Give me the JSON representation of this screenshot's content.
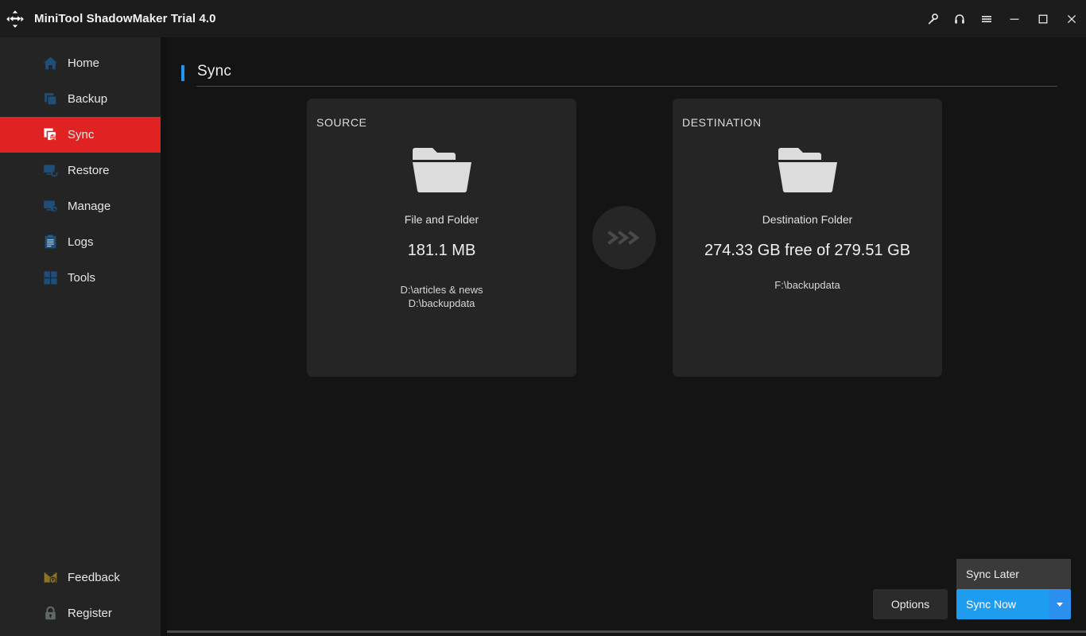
{
  "window": {
    "title": "MiniTool ShadowMaker Trial 4.0",
    "logo_icon": "refresh-circular-arrows-icon",
    "controls": [
      {
        "name": "key-icon",
        "tooltip": "Key"
      },
      {
        "name": "headset-icon",
        "tooltip": "Support"
      },
      {
        "name": "hamburger-icon",
        "tooltip": "Menu"
      },
      {
        "name": "minimize-icon",
        "tooltip": "Minimize"
      },
      {
        "name": "maximize-icon",
        "tooltip": "Maximize"
      },
      {
        "name": "close-icon",
        "tooltip": "Close"
      }
    ]
  },
  "sidebar": {
    "items": [
      {
        "label": "Home",
        "icon": "home-icon",
        "active": false
      },
      {
        "label": "Backup",
        "icon": "backup-copy-icon",
        "active": false
      },
      {
        "label": "Sync",
        "icon": "sync-folders-icon",
        "active": true
      },
      {
        "label": "Restore",
        "icon": "restore-monitor-icon",
        "active": false
      },
      {
        "label": "Manage",
        "icon": "manage-gear-icon",
        "active": false
      },
      {
        "label": "Logs",
        "icon": "logs-clipboard-icon",
        "active": false
      },
      {
        "label": "Tools",
        "icon": "tools-grid-icon",
        "active": false
      }
    ],
    "bottom_items": [
      {
        "label": "Feedback",
        "icon": "feedback-envelope-icon"
      },
      {
        "label": "Register",
        "icon": "register-lock-icon"
      }
    ]
  },
  "page": {
    "title": "Sync",
    "accent_color": "#2196f3"
  },
  "source": {
    "label": "SOURCE",
    "icon": "folder-icon",
    "type": "File and Folder",
    "size": "181.1 MB",
    "paths": [
      "D:\\articles & news",
      "D:\\backupdata"
    ]
  },
  "transfer": {
    "icon": "triple-chevron-right-icon"
  },
  "destination": {
    "label": "DESTINATION",
    "icon": "folder-icon",
    "type": "Destination Folder",
    "size": "274.33 GB free of 279.51 GB",
    "paths": [
      "F:\\backupdata"
    ]
  },
  "actions": {
    "sync_later_label": "Sync Later",
    "options_label": "Options",
    "sync_now_label": "Sync Now",
    "caret_icon": "chevron-down-icon",
    "primary_color": "#1e9cf0",
    "active_nav_color": "#e02322"
  }
}
